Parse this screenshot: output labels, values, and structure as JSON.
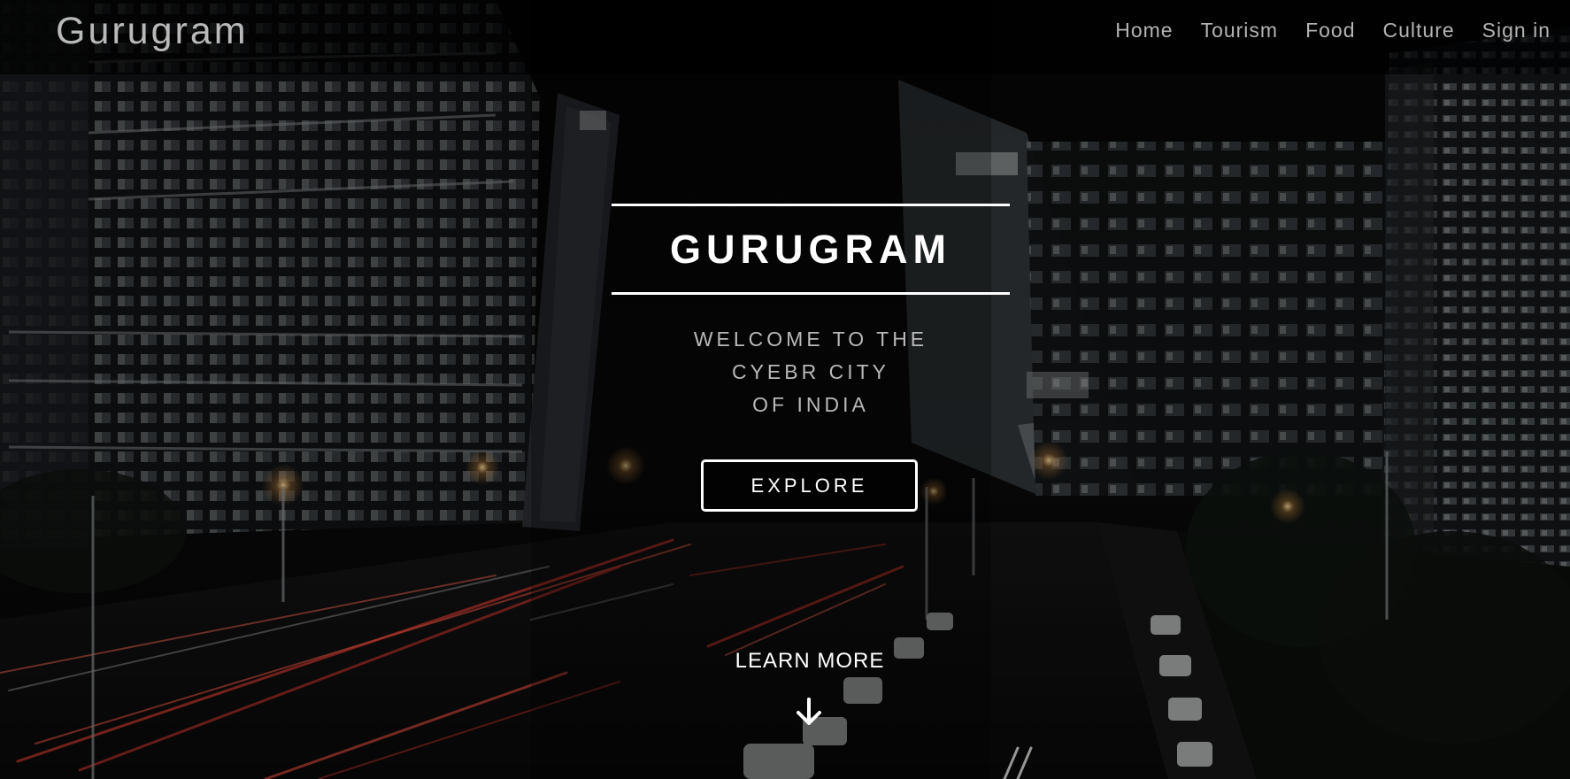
{
  "header": {
    "brand": "Gurugram",
    "nav": [
      {
        "label": "Home"
      },
      {
        "label": "Tourism"
      },
      {
        "label": "Food"
      },
      {
        "label": "Culture"
      },
      {
        "label": "Sign in"
      }
    ]
  },
  "hero": {
    "title": "GURUGRAM",
    "tagline": [
      "WELCOME TO THE",
      "CYEBR CITY",
      "OF INDIA"
    ],
    "explore_label": "EXPLORE",
    "learn_more_label": "LEARN MORE"
  },
  "icons": {
    "scroll": "arrow-down-icon"
  },
  "colors": {
    "overlay": "#000000",
    "text": "#ffffff",
    "nav_text": "#b4b4b4"
  }
}
